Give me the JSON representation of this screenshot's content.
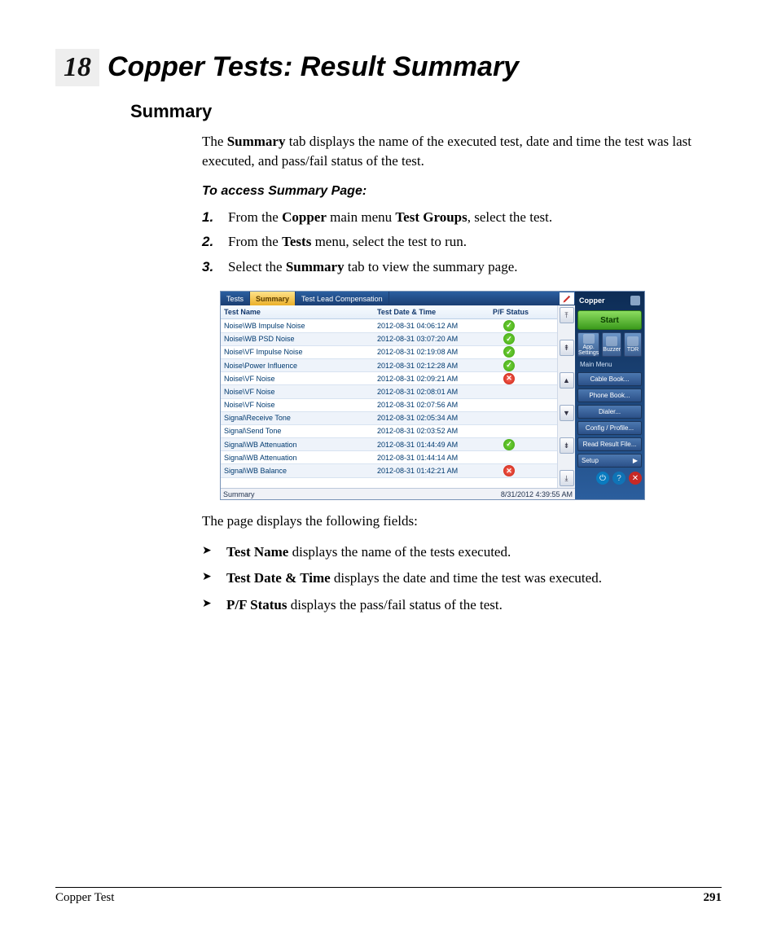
{
  "chapter": {
    "number": "18",
    "title": "Copper Tests: Result Summary"
  },
  "section": {
    "title": "Summary"
  },
  "intro": {
    "pre": "The ",
    "bold1": "Summary",
    "post": " tab displays the name of the executed test, date and time the test was last executed, and pass/fail status of the test."
  },
  "task_heading": "To access Summary Page:",
  "steps": {
    "s1": {
      "a": "From the ",
      "b": "Copper",
      "c": " main menu ",
      "d": "Test Groups",
      "e": ", select the test."
    },
    "s2": {
      "a": "From the ",
      "b": "Tests",
      "c": " menu, select the test to run."
    },
    "s3": {
      "a": "Select the ",
      "b": "Summary",
      "c": " tab to view the summary page."
    }
  },
  "fields_intro": "The page displays the following fields:",
  "fields": {
    "f1": {
      "b": "Test Name",
      "t": " displays the name of the tests executed."
    },
    "f2": {
      "b": "Test Date & Time",
      "t": " displays the date and time the test was executed."
    },
    "f3": {
      "b": "P/F Status",
      "t": " displays the pass/fail status of the test."
    }
  },
  "footer": {
    "left": "Copper Test",
    "page": "291"
  },
  "device": {
    "tabs": {
      "tests": "Tests",
      "summary": "Summary",
      "tlc": "Test Lead Compensation"
    },
    "headers": {
      "name": "Test Name",
      "date": "Test Date & Time",
      "pf": "P/F Status"
    },
    "rows": [
      {
        "name": "Noise\\WB Impulse Noise",
        "date": "2012-08-31 04:06:12 AM",
        "pf": "pass"
      },
      {
        "name": "Noise\\WB PSD Noise",
        "date": "2012-08-31 03:07:20 AM",
        "pf": "pass"
      },
      {
        "name": "Noise\\VF Impulse Noise",
        "date": "2012-08-31 02:19:08 AM",
        "pf": "pass"
      },
      {
        "name": "Noise\\Power Influence",
        "date": "2012-08-31 02:12:28 AM",
        "pf": "pass"
      },
      {
        "name": "Noise\\VF Noise",
        "date": "2012-08-31 02:09:21 AM",
        "pf": "fail"
      },
      {
        "name": "Noise\\VF Noise",
        "date": "2012-08-31 02:08:01 AM",
        "pf": ""
      },
      {
        "name": "Noise\\VF Noise",
        "date": "2012-08-31 02:07:56 AM",
        "pf": ""
      },
      {
        "name": "Signal\\Receive Tone",
        "date": "2012-08-31 02:05:34 AM",
        "pf": ""
      },
      {
        "name": "Signal\\Send Tone",
        "date": "2012-08-31 02:03:52 AM",
        "pf": ""
      },
      {
        "name": "Signal\\WB Attenuation",
        "date": "2012-08-31 01:44:49 AM",
        "pf": "pass"
      },
      {
        "name": "Signal\\WB Attenuation",
        "date": "2012-08-31 01:44:14 AM",
        "pf": ""
      },
      {
        "name": "Signal\\WB Balance",
        "date": "2012-08-31 01:42:21 AM",
        "pf": "fail"
      }
    ],
    "status_left": "Summary",
    "status_right": "8/31/2012 4:39:55 AM",
    "side": {
      "title": "Copper",
      "start": "Start",
      "icons": {
        "app": "App. Settings",
        "buzzer": "Buzzer",
        "tdr": "TDR"
      },
      "menu_head": "Main Menu",
      "items": {
        "cable": "Cable Book...",
        "phone": "Phone Book...",
        "dialer": "Dialer...",
        "config": "Config / Profile...",
        "read": "Read Result File...",
        "setup": "Setup"
      },
      "arrow": "▶"
    }
  }
}
